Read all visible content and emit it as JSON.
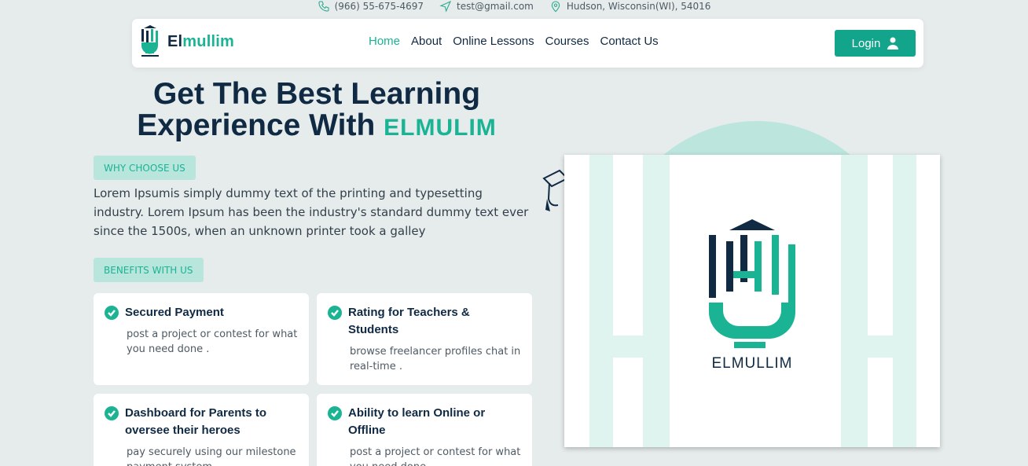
{
  "topbar": {
    "phone": "(966) 55-675-4697",
    "email": "test@gmail.com",
    "address": "Hudson, Wisconsin(WI), 54016"
  },
  "navbar": {
    "brand_prefix": "El",
    "brand_suffix": "mullim",
    "links": [
      "Home",
      "About",
      "Online Lessons",
      "Courses",
      "Contact Us"
    ],
    "active_link": "Home",
    "login_label": "Login"
  },
  "hero": {
    "title_line1": "Get The Best Learning",
    "title_line2": "Experience With",
    "title_brand": "ELMULIM",
    "why_badge": "WHY CHOOSE US",
    "description": "Lorem Ipsumis simply dummy text of the printing and typesetting industry. Lorem Ipsum has been the industry's standard dummy text ever since the 1500s, when an unknown printer took a galley",
    "benefits_badge": "BENEFITS WITH US"
  },
  "features": [
    {
      "title": "Secured Payment",
      "text": "post a project or contest for what you need done ."
    },
    {
      "title": "Rating for Teachers & Students",
      "text": "browse freelancer profiles chat in real-time ."
    },
    {
      "title": "Dashboard for Parents to oversee their heroes",
      "text": "pay securely using our milestone payment system."
    },
    {
      "title": "Ability to learn Online or Offline",
      "text": "post a project or contest for what you need done ."
    }
  ],
  "media": {
    "logo_caption": "ELMULLIM"
  },
  "colors": {
    "accent": "#1ab394",
    "navy": "#102a43",
    "page_bg": "#e6ecec"
  }
}
